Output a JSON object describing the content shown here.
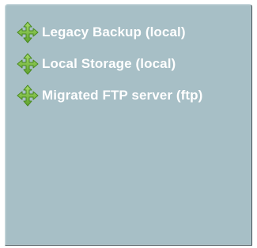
{
  "servers": [
    {
      "label": "Legacy Backup (local)",
      "icon": "move-arrows-icon"
    },
    {
      "label": "Local Storage (local)",
      "icon": "move-arrows-icon"
    },
    {
      "label": "Migrated FTP server (ftp)",
      "icon": "move-arrows-icon"
    }
  ],
  "colors": {
    "panel_bg": "#a7bfc6",
    "icon_green": "#7cc242",
    "icon_green_dark": "#4a8a22",
    "label_text": "#ffffff"
  }
}
